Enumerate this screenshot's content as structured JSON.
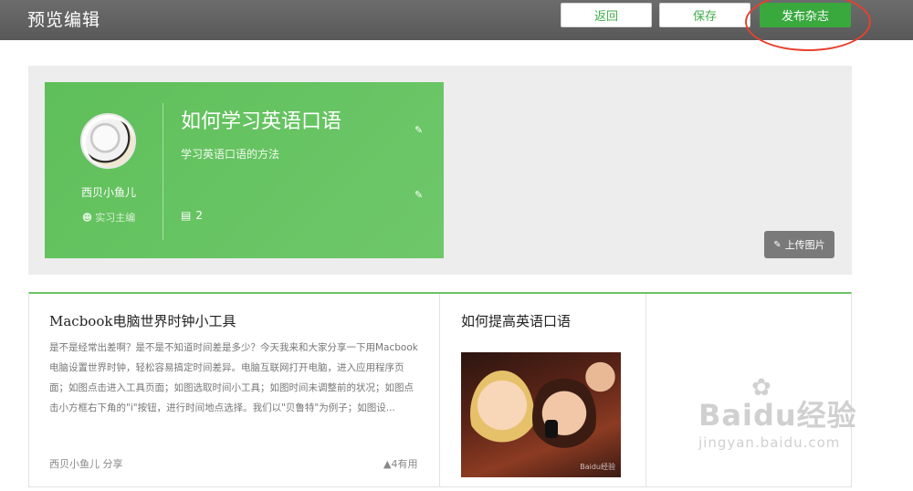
{
  "header": {
    "title": "预览编辑",
    "back_label": "返回",
    "save_label": "保存",
    "publish_label": "发布杂志"
  },
  "cover": {
    "username": "西贝小鱼儿",
    "role": "实习主编",
    "magazine_title": "如何学习英语口语",
    "magazine_subtitle": "学习英语口语的方法",
    "doc_count": "2",
    "upload_label": "上传图片"
  },
  "articles": [
    {
      "title": "Macbook电脑世界时钟小工具",
      "body": "是不是经常出差啊？是不是不知道时间差是多少？今天我来和大家分享一下用Macbook电脑设置世界时钟，轻松容易搞定时间差异。电脑互联网打开电脑，进入应用程序页面；如图点击进入工具页面；如图选取时间小工具；如图时间未调整前的状况；如图点击小方框右下角的\"i\"按钮，进行时间地点选择。我们以\"贝鲁特\"为例子；如图设...",
      "author": "西贝小鱼儿 分享",
      "useful": "4有用"
    },
    {
      "title": "如何提高英语口语",
      "image_watermark": "Baidu经验"
    }
  ],
  "watermark": {
    "brand": "Baidu经验",
    "url": "jingyan.baidu.com"
  },
  "colors": {
    "accent_green": "#39a93e",
    "card_green": "#66c462",
    "annotation_red": "#e8402f"
  },
  "icons": {
    "role": "user-icon",
    "edit": "pencil-icon",
    "doc": "document-icon",
    "useful": "thumbs-up-icon"
  }
}
